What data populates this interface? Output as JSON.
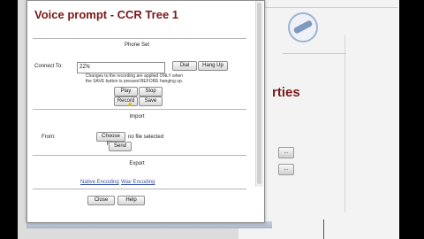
{
  "background_page": {
    "heading_fragment": "rties",
    "side_buttons": [
      "...",
      "..."
    ]
  },
  "popup": {
    "title": "Voice prompt - CCR Tree 1",
    "phone_set": {
      "section_title": "Phone Set",
      "connect_label": "Connect To:",
      "connect_value": "ZZN",
      "dial_label": "Dial",
      "hangup_label": "Hang Up",
      "note_line1": "Changes to the recording are applied ONLY when",
      "note_line2": "the SAVE button is pressed BEFORE hanging up.",
      "play_label": "Play",
      "stop_label": "Stop",
      "record_label": "Record",
      "save_label": "Save"
    },
    "import": {
      "section_title": "Import",
      "from_label": "From:",
      "choose_file_label": "Choose File",
      "no_file_text": "no file selected",
      "send_label": "Send"
    },
    "export": {
      "section_title": "Export",
      "link1": "Native Encoding",
      "link2": "Wav Encoding"
    },
    "footer": {
      "close_label": "Close",
      "help_label": "Help"
    }
  }
}
